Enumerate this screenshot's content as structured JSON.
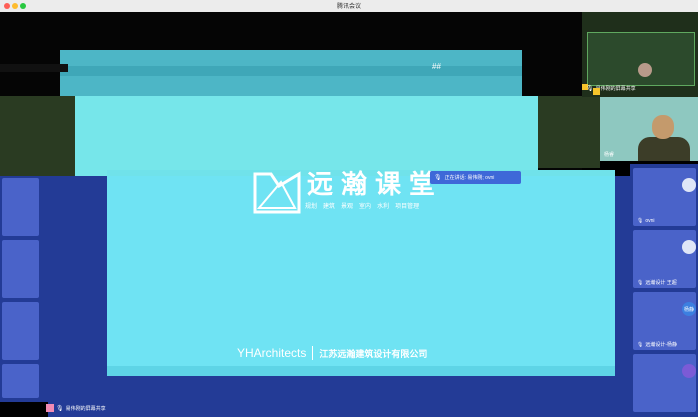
{
  "window": {
    "title": "腾讯会议"
  },
  "stray_text": "##",
  "speaking_indicator": "正在讲话: 易伟刚; ovni",
  "slide": {
    "brand_cn": "远瀚课堂",
    "tags": [
      "规划",
      "建筑",
      "景观",
      "室内",
      "水利",
      "项目管理"
    ],
    "footer_en": "YHArchitects",
    "footer_cn": "江苏远瀚建筑设计有限公司"
  },
  "top_right_thumb": {
    "label": "易伟刚的屏幕共享"
  },
  "camera": {
    "label": "杨睿"
  },
  "participants": [
    {
      "name": "ovni",
      "avatar": "",
      "color": "#dfe6f7"
    },
    {
      "name": "远瀚设计 王超",
      "avatar": "",
      "color": "#dfe6f7"
    },
    {
      "name": "远瀚设计-杨静",
      "avatar": "杨静",
      "color": "#3c7fe0"
    },
    {
      "name": "",
      "avatar": "",
      "color": "#7b5bd6"
    }
  ],
  "share_bar": {
    "label": "易伟刚的屏幕共享"
  },
  "colors": {
    "slide_bg": "#6fe3f3",
    "panel_bg": "#233b96",
    "tile_bg": "#4a63c9",
    "speaking_bg": "#3e68d8"
  },
  "icons": [
    "mic-icon",
    "screen-share-icon",
    "logo-icon"
  ]
}
